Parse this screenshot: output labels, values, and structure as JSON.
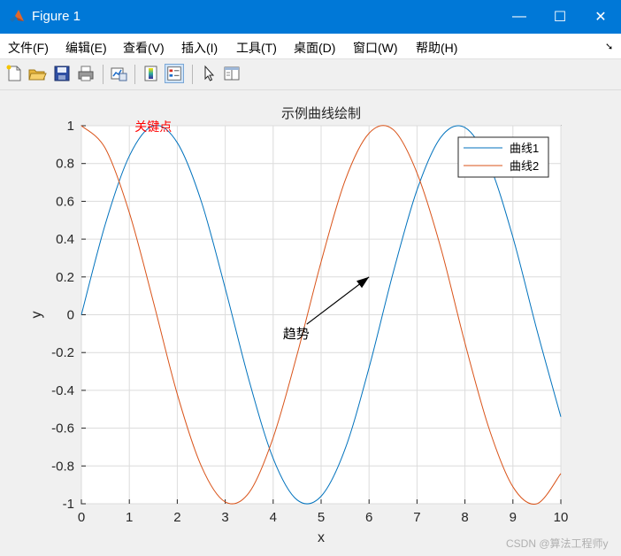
{
  "window": {
    "title": "Figure 1",
    "controls": {
      "minimize": "—",
      "maximize": "☐",
      "close": "✕"
    }
  },
  "menu": {
    "items": [
      "文件(F)",
      "编辑(E)",
      "查看(V)",
      "插入(I)",
      "工具(T)",
      "桌面(D)",
      "窗口(W)",
      "帮助(H)"
    ],
    "overflow": "➘"
  },
  "toolbar": {
    "icons": [
      "new-figure-icon",
      "open-file-icon",
      "save-icon",
      "print-icon",
      "link-plot-icon",
      "insert-colorbar-icon",
      "insert-legend-icon",
      "pointer-icon",
      "property-editor-icon"
    ],
    "active": "insert-legend-icon"
  },
  "colors": {
    "series1": "#0072bd",
    "series2": "#d95319",
    "annotation_text": "#ff0000",
    "grid": "#dcdcdc"
  },
  "chart_data": {
    "type": "line",
    "title": "示例曲线绘制",
    "xlabel": "x",
    "ylabel": "y",
    "xlim": [
      0,
      10
    ],
    "ylim": [
      -1,
      1
    ],
    "xticks": [
      "0",
      "1",
      "2",
      "3",
      "4",
      "5",
      "6",
      "7",
      "8",
      "9",
      "10"
    ],
    "yticks": [
      "-1",
      "-0.8",
      "-0.6",
      "-0.4",
      "-0.2",
      "0",
      "0.2",
      "0.4",
      "0.6",
      "0.8",
      "1"
    ],
    "grid": true,
    "legend_position": "top-right",
    "series": [
      {
        "name": "曲线1",
        "color": "#0072bd",
        "x": [
          0,
          0.5,
          1,
          1.5,
          2,
          2.5,
          3,
          3.5,
          4,
          4.5,
          5,
          5.5,
          6,
          6.5,
          7,
          7.5,
          8,
          8.5,
          9,
          9.5,
          10
        ],
        "y": [
          0,
          0.48,
          0.84,
          1.0,
          0.91,
          0.6,
          0.14,
          -0.35,
          -0.76,
          -0.98,
          -0.96,
          -0.71,
          -0.28,
          0.22,
          0.66,
          0.94,
          0.99,
          0.8,
          0.41,
          -0.08,
          -0.54
        ]
      },
      {
        "name": "曲线2",
        "color": "#d95319",
        "x": [
          0,
          0.5,
          1,
          1.5,
          2,
          2.5,
          3,
          3.5,
          4,
          4.5,
          5,
          5.5,
          6,
          6.5,
          7,
          7.5,
          8,
          8.5,
          9,
          9.5,
          10
        ],
        "y": [
          1.0,
          0.88,
          0.54,
          0.07,
          -0.42,
          -0.8,
          -0.99,
          -0.94,
          -0.65,
          -0.21,
          0.28,
          0.71,
          0.96,
          0.98,
          0.75,
          0.35,
          -0.15,
          -0.6,
          -0.91,
          -1.0,
          -0.84
        ]
      }
    ],
    "annotations": [
      {
        "text": "关键点",
        "x": 1.5,
        "y": 1.0
      },
      {
        "text": "趋势",
        "x": 4.7,
        "y": -0.1
      },
      {
        "type": "arrow",
        "from": [
          4.7,
          -0.05
        ],
        "to": [
          6.0,
          0.2
        ]
      }
    ]
  },
  "watermark": "CSDN @算法工程师y"
}
